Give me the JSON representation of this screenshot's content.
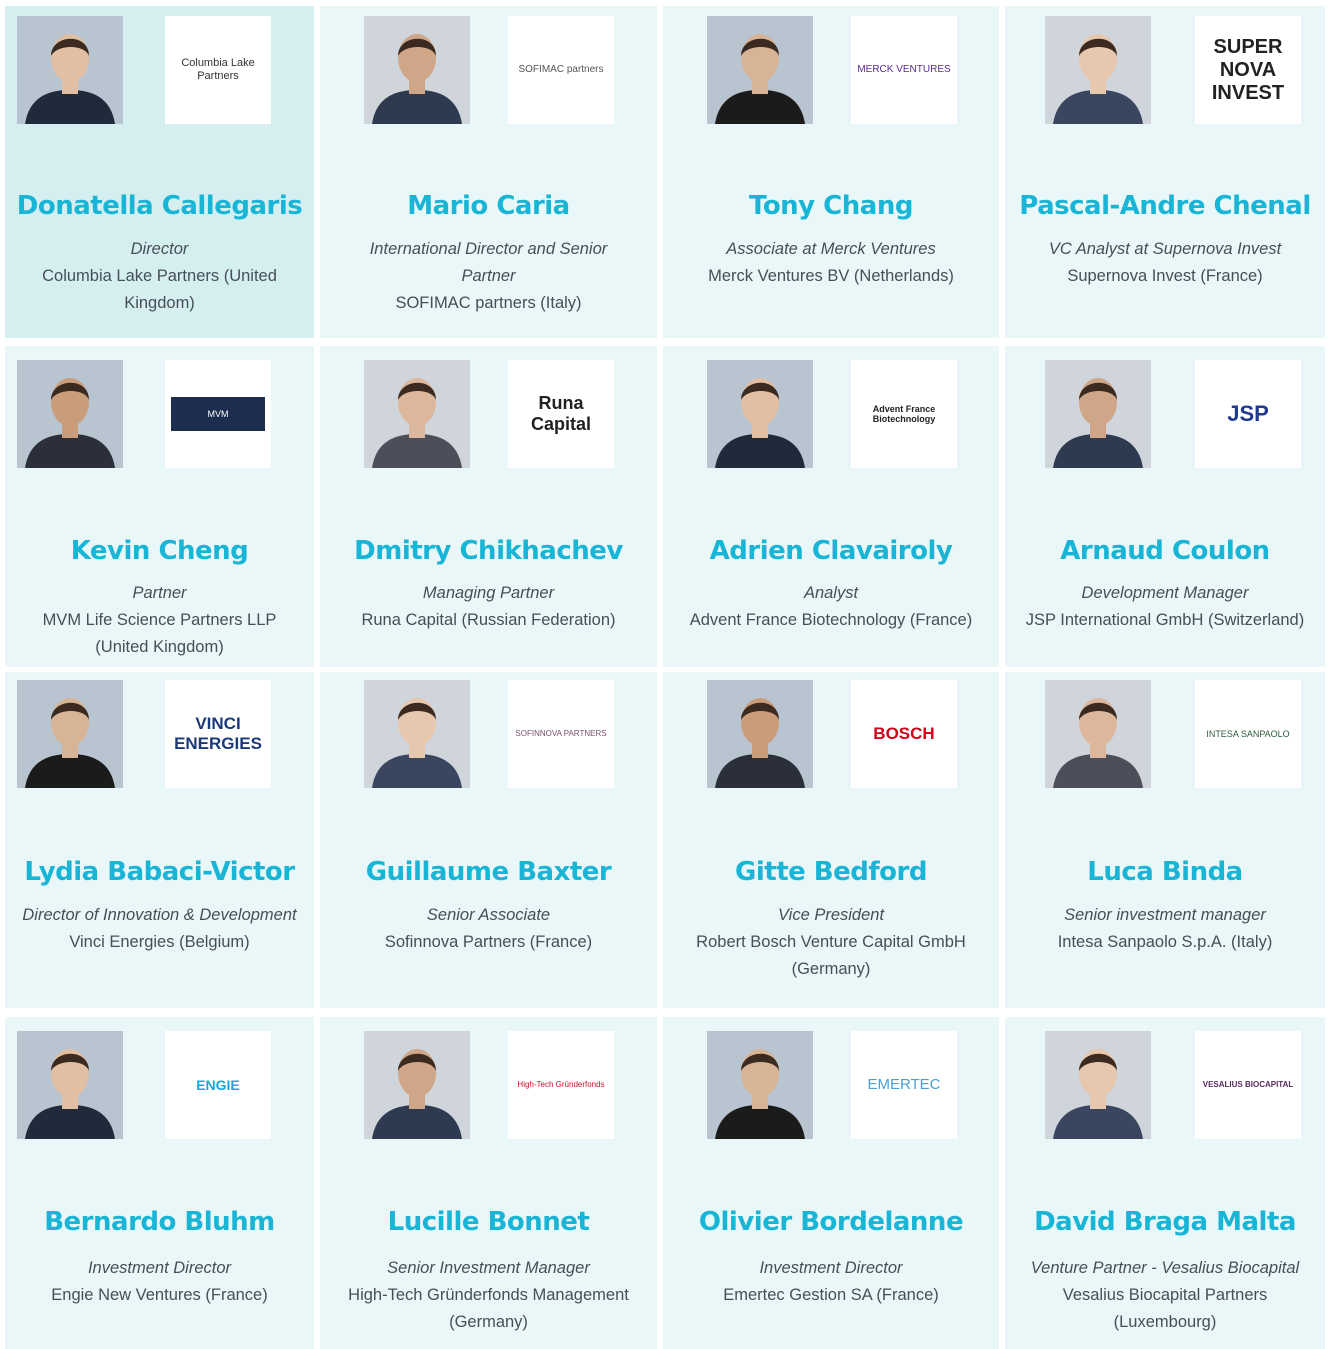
{
  "colors": {
    "card_bg": "#e9f7f8",
    "card_highlight": "#d5eff1",
    "name": "#18b5d6",
    "text": "#464f58"
  },
  "people": [
    {
      "name": "Donatella Callegaris",
      "role": "Director",
      "company_lines": [
        "Columbia Lake Partners (United",
        "Kingdom)"
      ],
      "logo_text": "Columbia Lake Partners",
      "photo_icon": "portrait-photo",
      "highlighted": true
    },
    {
      "name": "Mario Caria",
      "role_lines": [
        "International Director and Senior",
        "Partner"
      ],
      "company_lines": [
        "SOFIMAC partners (Italy)"
      ],
      "logo_text": "SOFIMAC partners",
      "photo_icon": "portrait-photo"
    },
    {
      "name": "Tony Chang",
      "role": "Associate at Merck Ventures",
      "company_lines": [
        "Merck Ventures BV (Netherlands)"
      ],
      "logo_text": "MERCK VENTURES",
      "photo_icon": "portrait-photo"
    },
    {
      "name": "Pascal-Andre Chenal",
      "role": "VC Analyst at Supernova Invest",
      "company_lines": [
        "Supernova Invest (France)"
      ],
      "logo_text": "SUPER NOVA INVEST",
      "photo_icon": "portrait-photo"
    },
    {
      "name": "Kevin Cheng",
      "role": "Partner",
      "company_lines": [
        "MVM Life Science Partners LLP",
        "(United Kingdom)"
      ],
      "logo_text": "MVM",
      "photo_icon": "portrait-photo"
    },
    {
      "name": "Dmitry Chikhachev",
      "role": "Managing Partner",
      "company_lines": [
        "Runa Capital (Russian Federation)"
      ],
      "logo_text": "Runa Capital",
      "photo_icon": "portrait-photo"
    },
    {
      "name": "Adrien Clavairoly",
      "role": "Analyst",
      "company_lines": [
        "Advent France Biotechnology (France)"
      ],
      "logo_text": "Advent France Biotechnology",
      "photo_icon": "portrait-photo"
    },
    {
      "name": "Arnaud Coulon",
      "role": "Development Manager",
      "company_lines": [
        "JSP International GmbH (Switzerland)"
      ],
      "logo_text": "JSP",
      "photo_icon": "portrait-photo"
    },
    {
      "name": "Lydia Babaci-Victor",
      "role": "Director of Innovation & Development",
      "company_lines": [
        "Vinci Energies (Belgium)"
      ],
      "logo_text": "VINCI ENERGIES",
      "photo_icon": "portrait-photo"
    },
    {
      "name": "Guillaume Baxter",
      "role": "Senior Associate",
      "company_lines": [
        "Sofinnova Partners (France)"
      ],
      "logo_text": "SOFINNOVA PARTNERS",
      "photo_icon": "portrait-photo"
    },
    {
      "name": "Gitte Bedford",
      "role": "Vice President",
      "company_lines": [
        "Robert Bosch Venture Capital GmbH",
        "(Germany)"
      ],
      "logo_text": "BOSCH",
      "photo_icon": "portrait-photo"
    },
    {
      "name": "Luca Binda",
      "role": "Senior investment manager",
      "company_lines": [
        "Intesa Sanpaolo S.p.A. (Italy)"
      ],
      "logo_text": "INTESA SANPAOLO",
      "photo_icon": "portrait-photo"
    },
    {
      "name": "Bernardo Bluhm",
      "role": "Investment Director",
      "company_lines": [
        "Engie New Ventures (France)"
      ],
      "logo_text": "ENGIE",
      "photo_icon": "portrait-photo"
    },
    {
      "name": "Lucille Bonnet",
      "role": "Senior Investment Manager",
      "company_lines": [
        "High-Tech Gründerfonds Management",
        "(Germany)"
      ],
      "logo_text": "High-Tech Gründerfonds",
      "photo_icon": "portrait-photo"
    },
    {
      "name": "Olivier Bordelanne",
      "role": "Investment Director",
      "company_lines": [
        "Emertec Gestion SA (France)"
      ],
      "logo_text": "EMERTEC",
      "photo_icon": "portrait-photo"
    },
    {
      "name": "David Braga Malta",
      "role": "Venture Partner - Vesalius Biocapital",
      "company_lines": [
        "Vesalius Biocapital Partners",
        "(Luxembourg)"
      ],
      "logo_text": "VESALIUS BIOCAPITAL",
      "photo_icon": "portrait-photo"
    }
  ]
}
